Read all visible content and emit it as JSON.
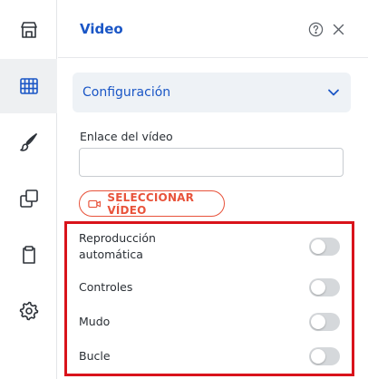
{
  "sidebar": {
    "items": [
      {
        "icon": "store-icon",
        "active": false
      },
      {
        "icon": "grid-icon",
        "active": true
      },
      {
        "icon": "brush-icon",
        "active": false
      },
      {
        "icon": "copy-icon",
        "active": false
      },
      {
        "icon": "clipboard-icon",
        "active": false
      },
      {
        "icon": "gear-icon",
        "active": false
      }
    ]
  },
  "panel": {
    "title": "Video",
    "help_icon": "help-circle-icon",
    "close_icon": "close-icon"
  },
  "accordion": {
    "label": "Configuración",
    "icon": "chevron-down-icon",
    "expanded": true
  },
  "video_link": {
    "label": "Enlace del vídeo",
    "value": "",
    "placeholder": ""
  },
  "select_video": {
    "label": "SELECCIONAR VÍDEO",
    "icon": "video-camera-icon"
  },
  "options": [
    {
      "label_line1": "Reproducción",
      "label_line2": "automática",
      "enabled": false
    },
    {
      "label": "Controles",
      "enabled": false
    },
    {
      "label": "Mudo",
      "enabled": false
    },
    {
      "label": "Bucle",
      "enabled": false
    }
  ],
  "colors": {
    "accent": "#1a56c6",
    "action": "#e8533b",
    "highlight": "#d9131b",
    "toggle_off": "#d5d8db"
  }
}
